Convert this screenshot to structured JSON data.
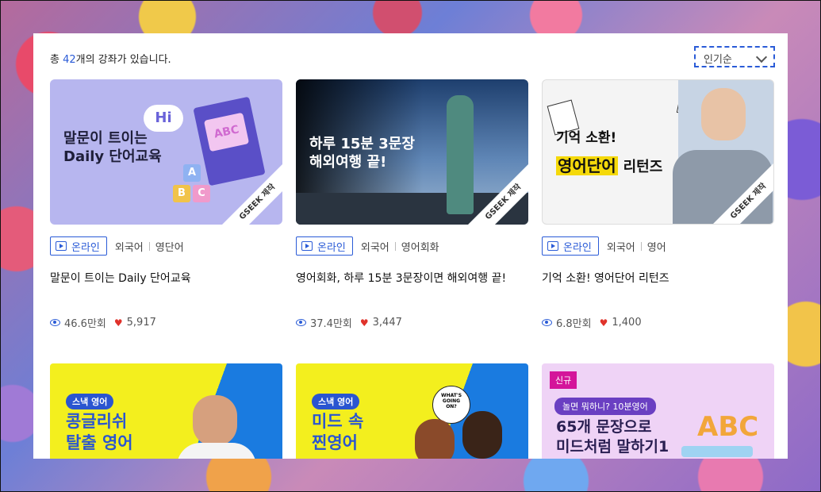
{
  "header": {
    "count_prefix": "총 ",
    "count_number": "42",
    "count_suffix": "개의 강좌가 있습니다.",
    "sort_label": "인기순"
  },
  "cards": [
    {
      "thumb_text": "말문이 트이는\nDaily 단어교육",
      "thumb_hi": "Hi",
      "thumb_abc": "ABC",
      "watermark": "GSEEK 제작",
      "badge": "온라인",
      "cat1": "외국어",
      "cat2": "영단어",
      "title": "말문이 트이는 Daily 단어교육",
      "views": "46.6만회",
      "likes": "5,917"
    },
    {
      "thumb_text": "하루 15분 3문장\n해외여행 끝!",
      "watermark": "GSEEK 제작",
      "badge": "온라인",
      "cat1": "외국어",
      "cat2": "영어회화",
      "title": "영어회화, 하루 15분 3문장이면 해외여행 끝!",
      "views": "37.4만회",
      "likes": "3,447"
    },
    {
      "thumb_text_1": "기억 소환!",
      "thumb_text_2": "영어단어",
      "thumb_text_3": "리턴즈",
      "watermark": "GSEEK 제작",
      "badge": "온라인",
      "cat1": "외국어",
      "cat2": "영어",
      "title": "기억 소환! 영어단어 리턴즈",
      "views": "6.8만회",
      "likes": "1,400"
    },
    {
      "thumb_tag": "스낵 영어",
      "thumb_text": "콩글리쉬\n탈출 영어"
    },
    {
      "thumb_tag": "스낵 영어",
      "thumb_text": "미드 속\n찐영어",
      "bubble": "WHAT'S\nGOING\nON?"
    },
    {
      "new_tag": "신규",
      "pill": "놀면 뭐하니? 10분영어",
      "thumb_text": "65개 문장으로\n미드처럼 말하기1"
    }
  ],
  "colors": {
    "accent": "#2a5bd7",
    "heart": "#e0322b",
    "new_tag": "#d4149a"
  }
}
